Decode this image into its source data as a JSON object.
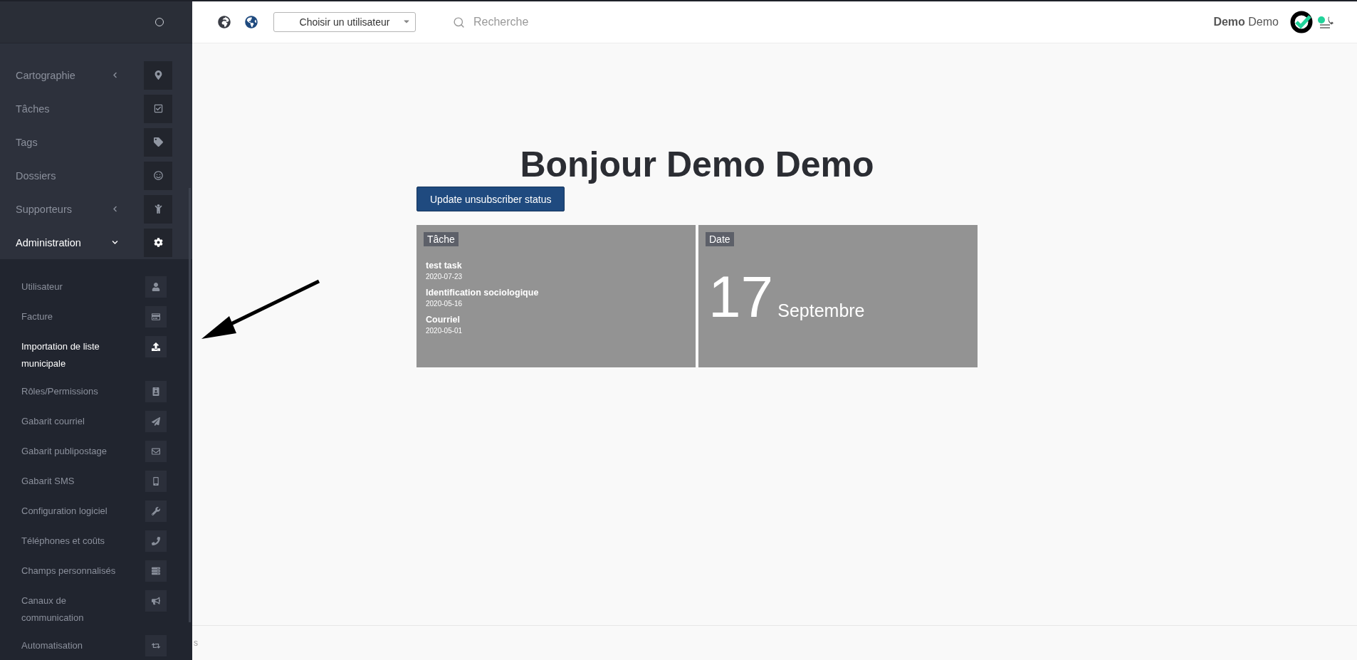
{
  "sidebar": {
    "menu": [
      {
        "label": "Cartographie",
        "expanded": false,
        "selected": false
      },
      {
        "label": "Tâches",
        "selected": false
      },
      {
        "label": "Tags",
        "selected": false
      },
      {
        "label": "Dossiers",
        "selected": false
      },
      {
        "label": "Supporteurs",
        "expanded": false,
        "selected": false
      },
      {
        "label": "Administration",
        "expanded": true,
        "selected": true,
        "children": [
          {
            "label": "Utilisateur",
            "selected": false
          },
          {
            "label": "Facture",
            "selected": false
          },
          {
            "label": "Importation de liste municipale",
            "selected": true
          },
          {
            "label": "Rôles/Permissions",
            "selected": false
          },
          {
            "label": "Gabarit courriel",
            "selected": false
          },
          {
            "label": "Gabarit publipostage",
            "selected": false
          },
          {
            "label": "Gabarit SMS",
            "selected": false
          },
          {
            "label": "Configuration logiciel",
            "selected": false
          },
          {
            "label": "Téléphones et coûts",
            "selected": false
          },
          {
            "label": "Champs personnalisés",
            "selected": false
          },
          {
            "label": "Canaux de communication",
            "selected": false
          },
          {
            "label": "Automatisation",
            "selected": false
          }
        ]
      }
    ]
  },
  "topbar": {
    "user_select": {
      "placeholder": "Choisir un utilisateur"
    },
    "search": {
      "placeholder": "Recherche"
    },
    "user_first": "Demo",
    "user_last": "Demo"
  },
  "main": {
    "title": "Bonjour Demo Demo",
    "button": "Update unsubscriber status",
    "tasks_card": {
      "label": "Tâche",
      "tasks": [
        {
          "name": "test task",
          "date": "2020-07-23"
        },
        {
          "name": "Identification sociologique",
          "date": "2020-05-16"
        },
        {
          "name": "Courriel",
          "date": "2020-05-01"
        }
      ]
    },
    "date_card": {
      "label": "Date",
      "day": "17",
      "month": "Septembre"
    }
  },
  "footer": {
    "text": "s"
  }
}
